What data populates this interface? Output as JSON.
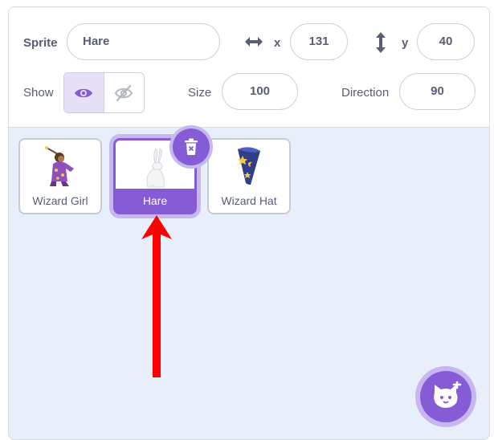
{
  "sprite_info": {
    "sprite_label": "Sprite",
    "sprite_name": "Hare",
    "x_label": "x",
    "x_value": "131",
    "y_label": "y",
    "y_value": "40",
    "show_label": "Show",
    "show_visible": true,
    "size_label": "Size",
    "size_value": "100",
    "direction_label": "Direction",
    "direction_value": "90"
  },
  "sprites": [
    {
      "name": "Wizard Girl",
      "selected": false,
      "icon": "wizard-girl-costume"
    },
    {
      "name": "Hare",
      "selected": true,
      "icon": "hare-costume"
    },
    {
      "name": "Wizard Hat",
      "selected": false,
      "icon": "wizard-hat-costume"
    }
  ],
  "colors": {
    "accent": "#855cd6",
    "annotation_arrow": "#ff0000",
    "text": "#575e75"
  }
}
